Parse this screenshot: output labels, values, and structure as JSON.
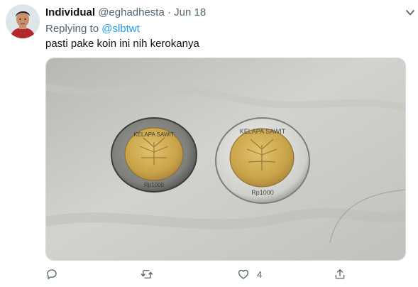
{
  "tweet": {
    "display_name": "Individual",
    "handle": "@eghadhesta",
    "separator": "·",
    "date": "Jun 18",
    "replying_prefix": "Replying to",
    "replying_handle": "@slbtwt",
    "text": "pasti pake koin ini nih kerokanya",
    "like_count": "4"
  },
  "media": {
    "coin_left_top_text": "KELAPA SAWIT",
    "coin_left_bottom_text": "Rp1000",
    "coin_right_top_text": "KELAPA SAWIT",
    "coin_right_bottom_text": "Rp1000"
  },
  "icons": {
    "avatar": "avatar-photo",
    "more": "chevron-down-icon",
    "reply": "reply-icon",
    "retweet": "retweet-icon",
    "like": "heart-icon",
    "share": "share-icon"
  },
  "colors": {
    "accent": "#1d9bf0",
    "secondary_text": "#536471",
    "primary_text": "#0f1419"
  }
}
